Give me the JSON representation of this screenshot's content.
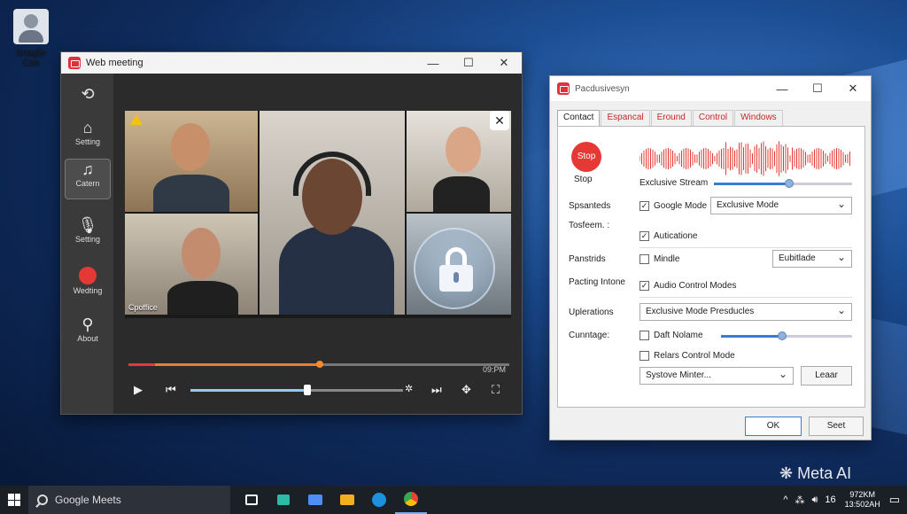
{
  "desktop": {
    "icon_label": "Snoglie Can",
    "watermark": "Meta AI"
  },
  "meeting": {
    "title": "Web meeting",
    "sidebar": [
      {
        "label": "",
        "icon": "refresh-icon"
      },
      {
        "label": "Setting",
        "icon": "home-icon"
      },
      {
        "label": "Catern",
        "icon": "music-note-icon"
      },
      {
        "label": "Setting",
        "icon": "microphone-icon"
      },
      {
        "label": "Wedting",
        "icon": "record-icon"
      },
      {
        "label": "About",
        "icon": "user-icon"
      }
    ],
    "tiles": [
      {
        "label": "Cpoffice"
      }
    ],
    "time": "09:PM"
  },
  "dialog": {
    "title": "Pacdusivesyn",
    "tabs": [
      "Contact",
      "Espancal",
      "Eround",
      "Control",
      "Windows"
    ],
    "stop": {
      "button": "Stop",
      "label": "Stop"
    },
    "exclusive_stream": "Exclusive Stream",
    "rows": {
      "spsanteds": "Spsanteds",
      "google_mode": "Google Mode",
      "exclusive_mode": "Exclusive Mode",
      "tosfeem": "Tosfeem. :",
      "auticatione": "Auticatione",
      "panstrids": "Panstrids",
      "mindle": "Mindle",
      "eubitlade": "Eubitlade",
      "pacting_intone": "Pacting Intone",
      "audio_control": "Audio Control Modes",
      "uplerations": "Uplerations",
      "presducles": "Exclusive Mode Presducles",
      "cunntage": "Cunntage:",
      "daft_nolame": "Daft Nolame",
      "relars": "Relars Control Mode",
      "systovle": "Systove Minter...",
      "leaar": "Leaar"
    },
    "checks": {
      "google_mode": true,
      "auticatione": true,
      "mindle": false,
      "audio_control": true,
      "daft_nolame": false,
      "relars": false
    },
    "ok": "OK",
    "seet": "Seet"
  },
  "taskbar": {
    "search_placeholder": "Google Meets",
    "tray_num": "16",
    "clock_time": "972KM",
    "clock_date": "13:502AH"
  }
}
